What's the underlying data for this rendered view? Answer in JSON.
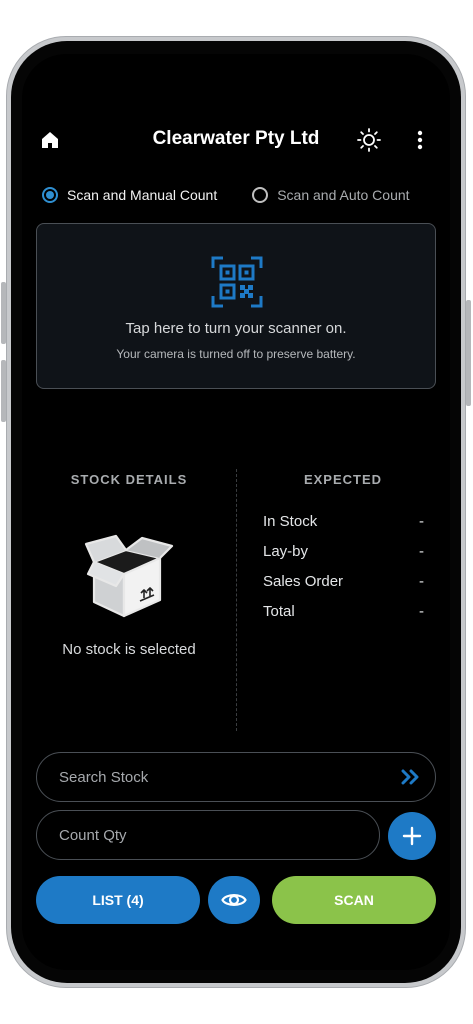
{
  "header": {
    "title": "Clearwater Pty Ltd",
    "home_icon": "home-icon",
    "theme_icon": "sun-icon",
    "menu_icon": "more-vertical-icon"
  },
  "count_mode": {
    "options": [
      {
        "label": "Scan and Manual Count",
        "selected": true
      },
      {
        "label": "Scan and Auto Count",
        "selected": false
      }
    ]
  },
  "scanner": {
    "icon": "qr-scan-icon",
    "title": "Tap here to turn your scanner on.",
    "subtitle": "Your camera is turned off to preserve battery."
  },
  "stock_details": {
    "heading": "STOCK DETAILS",
    "icon": "open-box-icon",
    "empty_text": "No stock is selected"
  },
  "expected": {
    "heading": "EXPECTED",
    "rows": [
      {
        "label": "In Stock",
        "value": "-"
      },
      {
        "label": "Lay-by",
        "value": "-"
      },
      {
        "label": "Sales Order",
        "value": "-"
      },
      {
        "label": "Total",
        "value": "-"
      }
    ]
  },
  "search": {
    "placeholder": "Search Stock",
    "icon": "double-chevron-right-icon"
  },
  "count_qty": {
    "placeholder": "Count Qty",
    "add_icon": "plus-icon"
  },
  "actions": {
    "list_label": "LIST (4)",
    "view_icon": "eye-icon",
    "scan_label": "SCAN"
  },
  "colors": {
    "accent_blue": "#1e7ac6",
    "radio_blue": "#2f8fd1",
    "scan_green": "#8bc34a",
    "background": "#000000"
  }
}
